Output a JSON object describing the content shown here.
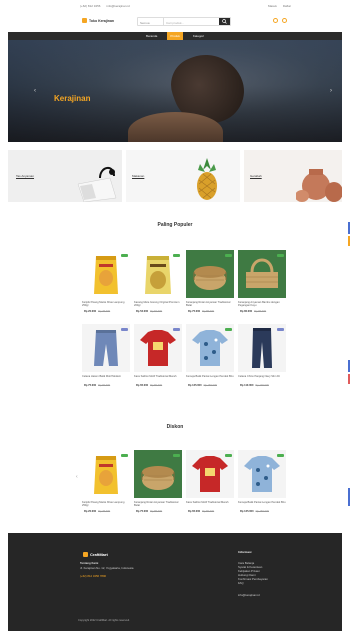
{
  "topbar": {
    "left_items": [
      "(+62) 812 3456",
      "info@kerajinan.id"
    ],
    "right_items": [
      "Masuk",
      "Daftar"
    ]
  },
  "header": {
    "logo_text": "Toko Kerajinan",
    "search_category": "Semua",
    "search_placeholder": "Cari produk...",
    "search_icon": "search-icon"
  },
  "nav": {
    "items": [
      "Beranda",
      "Produk",
      "Kategori"
    ],
    "active_index": 1
  },
  "hero": {
    "title": "Kerajinan"
  },
  "banners": [
    {
      "label": "Tas Anyaman"
    },
    {
      "label": "Makanan"
    },
    {
      "label": "Gerabah"
    }
  ],
  "popular": {
    "title": "Paling Populer",
    "products": [
      {
        "name": "Keripik Pisang Manis Khas Lampung 250gr",
        "price_old": "Rp 25.000",
        "price_new": "Rp 20.000",
        "badge_color": "#4caf50",
        "img": "chips-bag"
      },
      {
        "name": "Kacang Mete Goreng Original Premium 200gr",
        "price_old": "Rp 60.000",
        "price_new": "Rp 52.000",
        "badge_color": "#4caf50",
        "img": "nuts-bag"
      },
      {
        "name": "Keranjang Rotan Anyaman Tradisional Bulat",
        "price_old": "Rp 85.000",
        "price_new": "Rp 75.000",
        "badge_color": "#4caf50",
        "img": "basket-round"
      },
      {
        "name": "Keranjang Anyaman Bambu dengan Pegangan Kayu",
        "price_old": "Rp 95.000",
        "price_new": "Rp 80.000",
        "badge_color": "#4caf50",
        "img": "basket-handle"
      },
      {
        "name": "Celana Harem Batik Motif Modern",
        "price_old": "Rp 90.000",
        "price_new": "Rp 75.000",
        "badge_color": "#7986cb",
        "img": "pants-blue"
      },
      {
        "name": "Kaos Sablon Motif Tradisional Merah",
        "price_old": "Rp 80.000",
        "price_new": "Rp 65.000",
        "badge_color": "#7986cb",
        "img": "tshirt-red"
      },
      {
        "name": "Kemeja Batik Pantai Lengan Pendek Biru",
        "price_old": "Rp 150.000",
        "price_new": "Rp 125.000",
        "badge_color": "#4caf50",
        "img": "shirt-batik"
      },
      {
        "name": "Celana Chino Panjang Navy Slim Fit",
        "price_old": "Rp 130.000",
        "price_new": "Rp 110.000",
        "badge_color": "#7986cb",
        "img": "pants-navy"
      }
    ]
  },
  "discount": {
    "title": "Diskon",
    "products": [
      {
        "name": "Keripik Pisang Manis Khas Lampung 250gr",
        "price_old": "Rp 25.000",
        "price_new": "Rp 20.000",
        "badge_color": "#4caf50",
        "img": "chips-bag"
      },
      {
        "name": "Keranjang Rotan Anyaman Tradisional Bulat",
        "price_old": "Rp 85.000",
        "price_new": "Rp 75.000",
        "badge_color": "#4caf50",
        "img": "basket-round"
      },
      {
        "name": "Kaos Sablon Motif Tradisional Merah",
        "price_old": "Rp 80.000",
        "price_new": "Rp 65.000",
        "badge_color": "#4caf50",
        "img": "tshirt-red"
      },
      {
        "name": "Kemeja Batik Pantai Lengan Pendek Biru",
        "price_old": "Rp 150.000",
        "price_new": "Rp 125.000",
        "badge_color": "#4caf50",
        "img": "shirt-batik"
      }
    ]
  },
  "footer": {
    "logo_text": "CraftMart",
    "about_title": "Tentang Kami",
    "about_lines": [
      "Jl. Kerajinan No. 12, Yogyakarta, Indonesia",
      "(+62) 812 3456 7890"
    ],
    "links_title": "Informasi",
    "links": [
      "Cara Belanja",
      "Syarat & Ketentuan",
      "Kebijakan Privasi",
      "Hubungi Kami",
      "Konfirmasi Pembayaran",
      "FAQ"
    ],
    "newsletter": "info@kerajinan.id",
    "copyright": "Copyright 2022 CraftMart. All rights reserved."
  },
  "colors": {
    "accent": "#f5a623",
    "dark": "#2b2b2b",
    "footer_bg": "#262626"
  }
}
